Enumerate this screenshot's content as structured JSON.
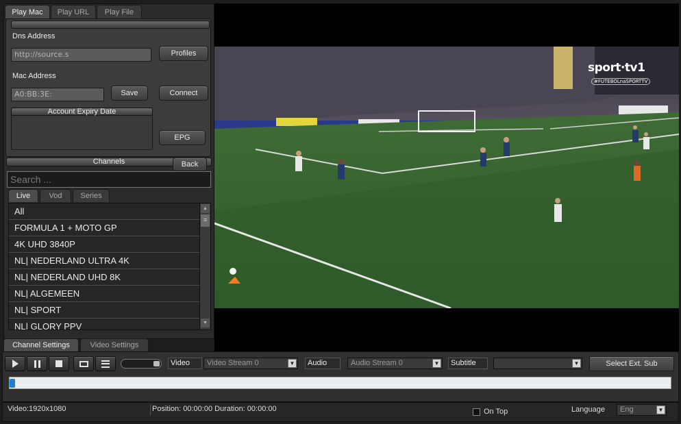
{
  "left_tabs": [
    "Play Mac",
    "Play URL",
    "Play File"
  ],
  "dns": {
    "label": "Dns Address",
    "value": "http://source.s",
    "profiles_btn": "Profiles"
  },
  "mac": {
    "label": "Mac Address",
    "value": "A0:BB:3E:",
    "save_btn": "Save",
    "connect_btn": "Connect"
  },
  "expiry": {
    "label": "Account Expiry Date",
    "epg_btn": "EPG"
  },
  "channels": {
    "header": "Channels",
    "back_btn": "Back",
    "search_placeholder": "Search ...",
    "subtabs": [
      "Live",
      "Vod",
      "Series"
    ],
    "items": [
      "All",
      "FORMULA 1 + MOTO GP",
      "4K UHD 3840P",
      "NL| NEDERLAND ULTRA 4K",
      "NL| NEDERLAND UHD 8K",
      "NL| ALGEMEEN",
      "NL| SPORT",
      "NL| GLORY PPV"
    ]
  },
  "settings_tabs": [
    "Channel Settings",
    "Video Settings"
  ],
  "video": {
    "broadcaster_logo": "sport·tv1",
    "broadcaster_hashtag": "#FUTEBOLnaSPORTTV"
  },
  "controls": {
    "video_label": "Video",
    "video_stream": "Video Stream 0",
    "audio_label": "Audio",
    "audio_stream": "Audio Stream 0",
    "subtitle_label": "Subtitle",
    "subtitle_value": "",
    "select_ext_sub": "Select Ext. Sub",
    "progress": 0
  },
  "status": {
    "video_info": "Video:1920x1080",
    "position": "Position: 00:00:00 Duration: 00:00:00",
    "on_top": "On Top",
    "language_label": "Language",
    "language_value": "Eng"
  }
}
